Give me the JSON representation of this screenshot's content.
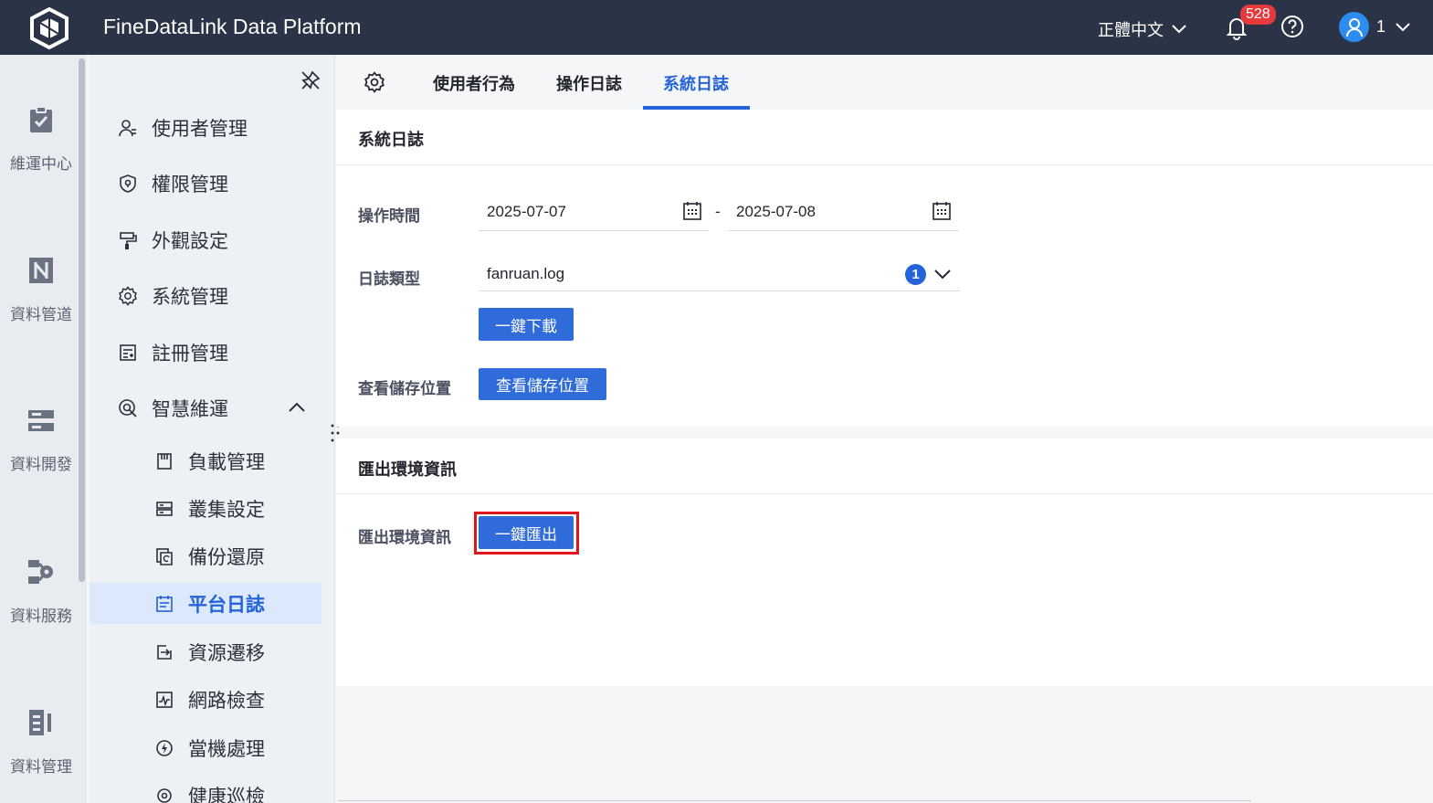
{
  "header": {
    "app_title": "FineDataLink Data Platform",
    "language": "正體中文",
    "notification_count": "528",
    "user_name": "1"
  },
  "rail": {
    "items": [
      {
        "label": "維運中心",
        "icon": "clipboard-check-icon"
      },
      {
        "label": "資料管道",
        "icon": "pipeline-icon"
      },
      {
        "label": "資料開發",
        "icon": "dev-server-icon"
      },
      {
        "label": "資料服務",
        "icon": "data-service-icon"
      },
      {
        "label": "資料管理",
        "icon": "data-management-icon"
      }
    ]
  },
  "sidebar": {
    "items": [
      {
        "label": "使用者管理",
        "icon": "user-icon"
      },
      {
        "label": "權限管理",
        "icon": "shield-icon"
      },
      {
        "label": "外觀設定",
        "icon": "paint-roller-icon"
      },
      {
        "label": "系統管理",
        "icon": "gear-icon"
      },
      {
        "label": "註冊管理",
        "icon": "register-icon"
      },
      {
        "label": "智慧維運",
        "icon": "smart-ops-icon"
      }
    ],
    "sub_items": [
      {
        "label": "負載管理",
        "icon": "load-icon"
      },
      {
        "label": "叢集設定",
        "icon": "cluster-icon"
      },
      {
        "label": "備份還原",
        "icon": "backup-icon"
      },
      {
        "label": "平台日誌",
        "icon": "log-icon"
      },
      {
        "label": "資源遷移",
        "icon": "migrate-icon"
      },
      {
        "label": "網路檢查",
        "icon": "network-check-icon"
      },
      {
        "label": "當機處理",
        "icon": "crash-icon"
      },
      {
        "label": "健康巡檢",
        "icon": "health-check-icon"
      }
    ]
  },
  "tabs": [
    {
      "label": "使用者行為"
    },
    {
      "label": "操作日誌"
    },
    {
      "label": "系統日誌"
    }
  ],
  "system_log": {
    "section_title": "系統日誌",
    "time_label": "操作時間",
    "start_date": "2025-07-07",
    "date_separator": "-",
    "end_date": "2025-07-08",
    "type_label": "日誌類型",
    "type_value": "fanruan.log",
    "type_count": "1",
    "download_button": "一鍵下載",
    "storage_label": "查看儲存位置",
    "storage_button": "查看儲存位置"
  },
  "export_env": {
    "section_title": "匯出環境資訊",
    "row_label": "匯出環境資訊",
    "export_button": "一鍵匯出"
  },
  "colors": {
    "topbar": "#2b3446",
    "accent": "#2463d9",
    "button": "#2f6bd9",
    "badge": "#e5393b",
    "highlight": "#e3141b"
  }
}
